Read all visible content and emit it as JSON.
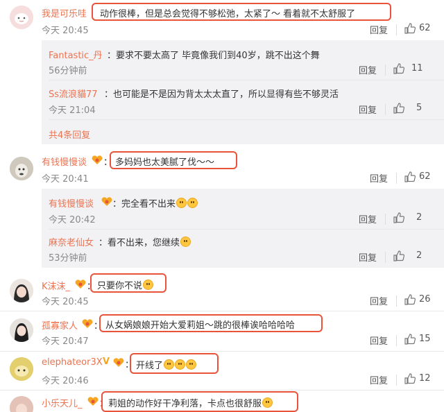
{
  "comments": [
    {
      "user": "我是可乐哇",
      "text": "动作很棒，但是总会觉得不够松弛，太紧了～ 看着就不太舒服了",
      "time": "今天 20:45",
      "reply_label": "回复",
      "likes": "62",
      "sub_replies": [
        {
          "user": "Fantastic_丹",
          "text": "要求不要太高了 毕竟像我们到40岁，跳不出这个舞",
          "time": "56分钟前",
          "reply_label": "回复",
          "likes": "11"
        },
        {
          "user": "Ss流浪貓77",
          "text": "也可能是不是因为背太太太直了，所以显得有些不够灵活",
          "time": "今天 21:04",
          "reply_label": "回复",
          "likes": "5"
        }
      ],
      "more_replies": "共4条回复"
    },
    {
      "user": "有钱慢慢谈",
      "text": "多妈妈也太美腻了伐～～",
      "time": "今天 20:41",
      "reply_label": "回复",
      "likes": "62",
      "sub_replies": [
        {
          "user": "有钱慢慢谈",
          "text": "完全看不出来",
          "time": "今天 20:42",
          "reply_label": "回复",
          "likes": "2"
        },
        {
          "user": "麻奈老仙女",
          "text": "看不出来，您继续",
          "time": "53分钟前",
          "reply_label": "回复",
          "likes": "2"
        }
      ]
    },
    {
      "user": "K沫沫_",
      "text": "只要你不说",
      "time": "今天 20:45",
      "reply_label": "回复",
      "likes": "26"
    },
    {
      "user": "孤寡家人",
      "text": "从女娲娘娘开始大爱莉姐～跳的很棒诶哈哈哈哈",
      "time": "今天 20:47",
      "reply_label": "回复",
      "likes": "15"
    },
    {
      "user": "elephateor3X",
      "text": "开线了",
      "time": "今天 20:46",
      "reply_label": "回复",
      "likes": "12"
    },
    {
      "user": "小乐天儿_",
      "text": "莉姐的动作好干净利落，卡点也很舒服"
    }
  ],
  "colors": {
    "username": "#eb7350",
    "highlight": "#e8533a",
    "subbox": "#f2f2f5"
  },
  "icons": {
    "like": "thumbs-up-icon",
    "badge": "fan-badge-icon",
    "emoji": "emoji-icon"
  }
}
